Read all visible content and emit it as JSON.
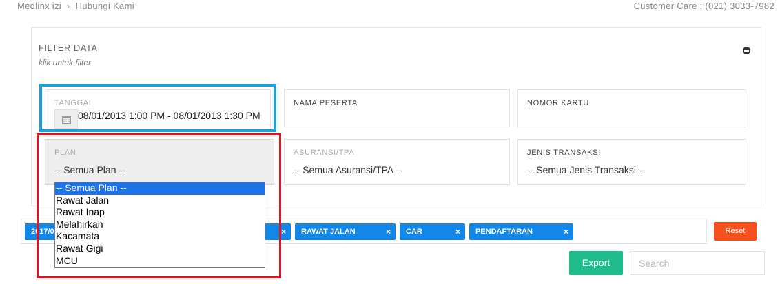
{
  "breadcrumb": {
    "home": "Medlinx izi",
    "separator": "›",
    "current": "Hubungi Kami"
  },
  "customer_care": "Customer Care : (021) 3033-7982",
  "filter": {
    "title": "FILTER DATA",
    "subtitle": "klik untuk filter",
    "fields": {
      "tanggal": {
        "label": "TANGGAL",
        "value": "08/01/2013 1:00 PM - 08/01/2013 1:30 PM",
        "icon": "calendar-icon"
      },
      "nama_peserta": {
        "label": "NAMA PESERTA",
        "value": ""
      },
      "nomor_kartu": {
        "label": "NOMOR KARTU",
        "value": ""
      },
      "plan": {
        "label": "PLAN",
        "value": "-- Semua Plan --"
      },
      "asuransi": {
        "label": "ASURANSI/TPA",
        "value": "-- Semua Asuransi/TPA --"
      },
      "jenis_transaksi": {
        "label": "JENIS TRANSAKSI",
        "value": "-- Semua Jenis Transaksi --"
      }
    }
  },
  "plan_dropdown": {
    "selected_index": 0,
    "options": [
      "-- Semua Plan --",
      "Rawat Jalan",
      "Rawat Inap",
      "Melahirkan",
      "Kacamata",
      "Rawat Gigi",
      "MCU"
    ]
  },
  "tags": [
    {
      "label": "2017/0",
      "remove": "×"
    },
    {
      "label": "RAWAT JALAN",
      "remove": "×"
    },
    {
      "label": "CAR",
      "remove": "×"
    },
    {
      "label": "PENDAFTARAN",
      "remove": "×"
    }
  ],
  "buttons": {
    "reset": "Reset",
    "export": "Export"
  },
  "search": {
    "placeholder": "Search",
    "value": ""
  },
  "colors": {
    "tag_blue": "#1287e8",
    "reset_orange": "#f4511e",
    "export_green": "#1fbc8c",
    "highlight_blue": "#1aa0db",
    "highlight_red": "#e0131f",
    "select_blue": "#1e74e6"
  }
}
